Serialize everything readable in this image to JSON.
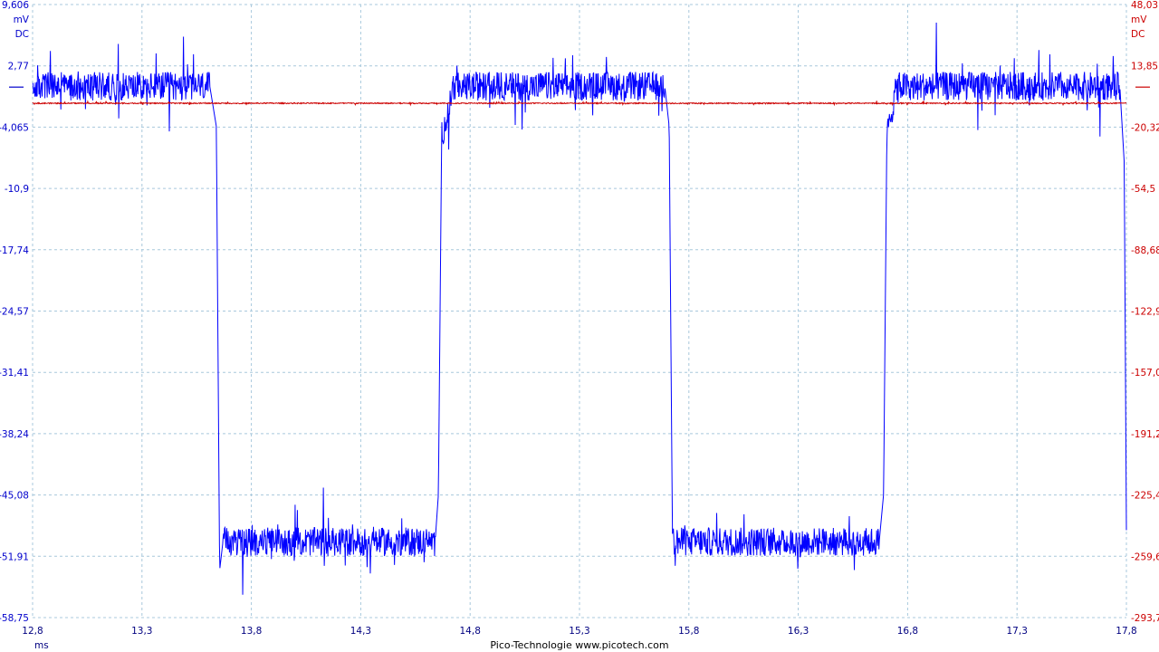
{
  "footer_text": "Pico-Technologie  www.picotech.com",
  "chart_data": {
    "type": "line",
    "title": "",
    "x_unit": "ms",
    "xlim": [
      12.8,
      17.8
    ],
    "x_ticks": [
      "12,8",
      "13,3",
      "13,8",
      "14,3",
      "14,8",
      "15,3",
      "15,8",
      "16,3",
      "16,8",
      "17,3",
      "17,8"
    ],
    "grid": true,
    "grid_style": "dashed",
    "left_axis": {
      "unit": "mV",
      "coupling": "DC",
      "color": "#0000cc",
      "ylim": [
        -58.75,
        9.606
      ],
      "ticks": [
        "9,606",
        "2,77",
        "-4,065",
        "-10,9",
        "-17,74",
        "-24,57",
        "-31,41",
        "-38,24",
        "-45,08",
        "-51,91",
        "-58,75"
      ]
    },
    "right_axis": {
      "unit": "mV",
      "coupling": "DC",
      "color": "#cc0000",
      "ylim": [
        -293.7,
        48.03
      ],
      "ticks": [
        "48,03",
        "13,85",
        "-20,32",
        "-54,5",
        "-88,68",
        "-122,9",
        "-157,0",
        "-191,2",
        "-225,4",
        "-259,6",
        "-293,7"
      ]
    },
    "series": [
      {
        "axis": "left",
        "color": "#0000ff",
        "shape": "square wave",
        "high_level_mV": 0.5,
        "low_level_mV": -50.3,
        "noise_mV": 1.6,
        "points": [
          [
            12.8,
            0.5
          ],
          [
            13.61,
            0.5
          ],
          [
            13.64,
            -4.0
          ],
          [
            13.655,
            -53.5
          ],
          [
            13.67,
            -50.3
          ],
          [
            14.64,
            -50.3
          ],
          [
            14.655,
            -45.0
          ],
          [
            14.67,
            -5.0
          ],
          [
            14.7,
            -2.5
          ],
          [
            14.72,
            0.5
          ],
          [
            15.69,
            0.5
          ],
          [
            15.71,
            -4.0
          ],
          [
            15.725,
            -50.0
          ],
          [
            15.74,
            -50.3
          ],
          [
            16.67,
            -50.3
          ],
          [
            16.69,
            -45.0
          ],
          [
            16.705,
            -5.0
          ],
          [
            16.73,
            -2.0
          ],
          [
            16.75,
            0.5
          ],
          [
            17.77,
            0.5
          ],
          [
            17.79,
            -8.0
          ],
          [
            17.8,
            -49.0
          ]
        ]
      },
      {
        "axis": "right",
        "color": "#cc0000",
        "shape": "flat",
        "level_mV": -7.0,
        "noise_mV": 0.3,
        "points": [
          [
            12.8,
            -7.0
          ],
          [
            17.8,
            -7.0
          ]
        ]
      }
    ]
  }
}
